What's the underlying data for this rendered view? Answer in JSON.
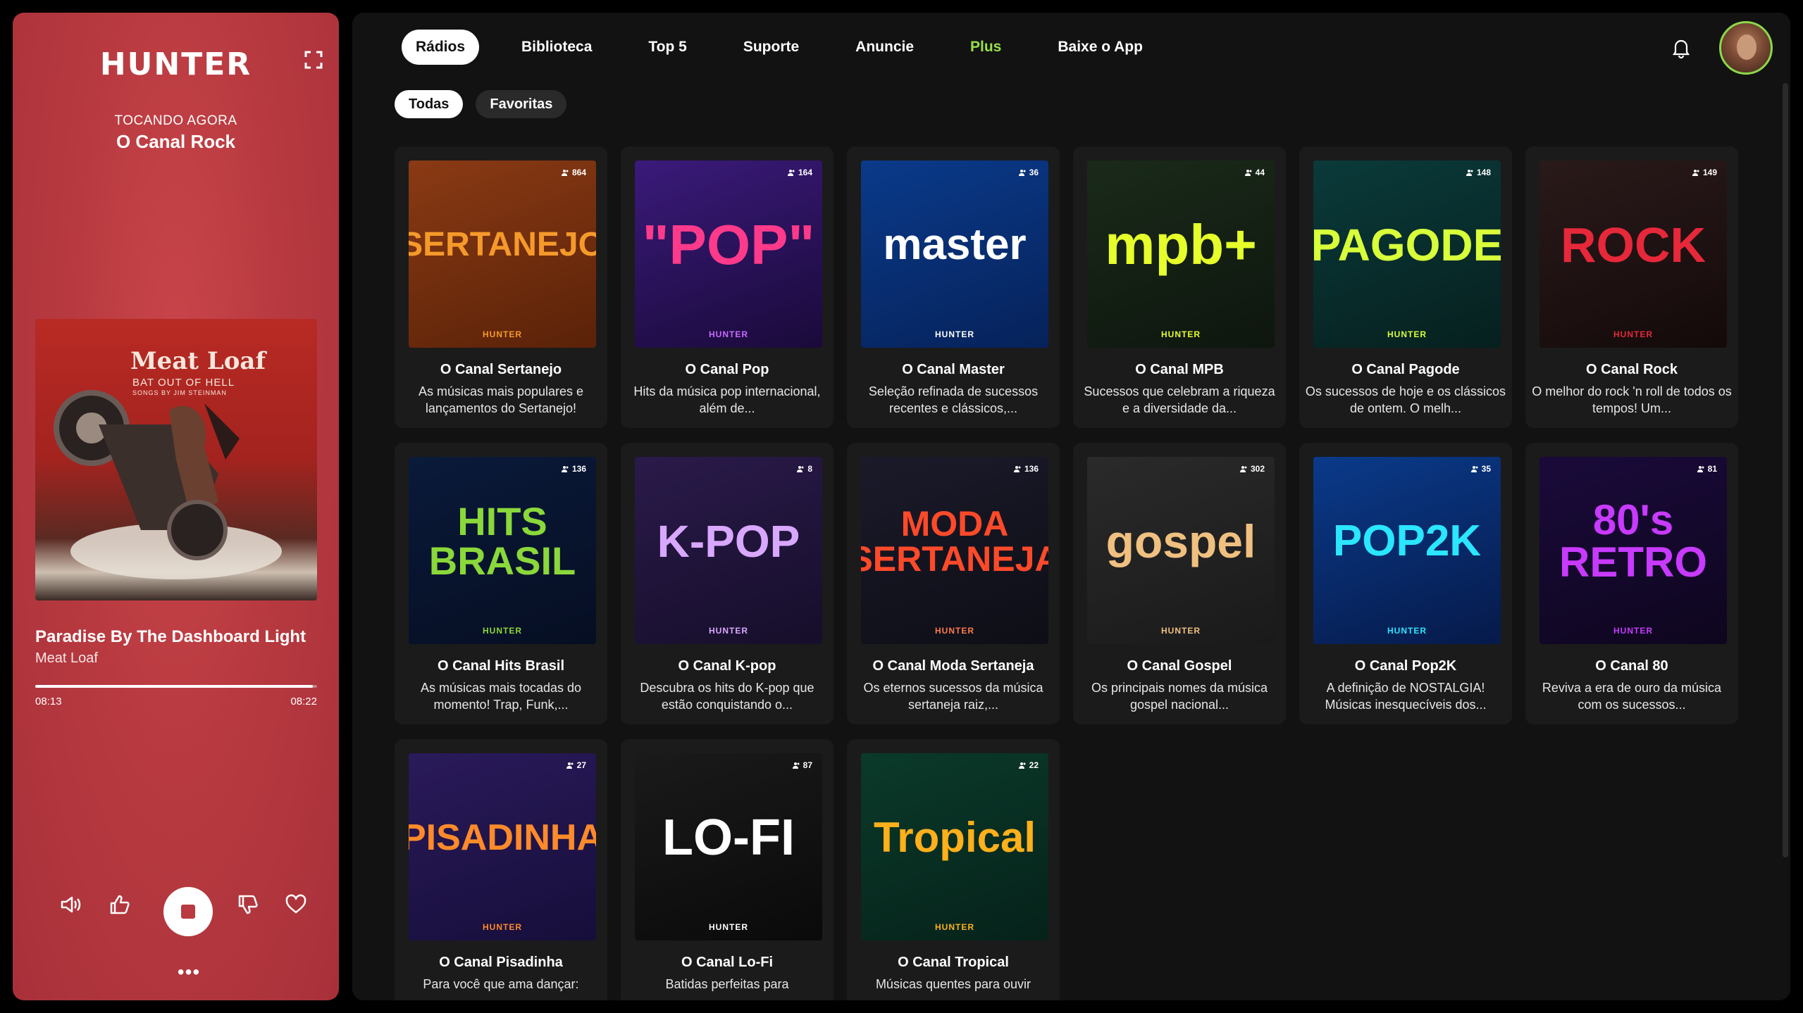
{
  "player": {
    "logo": "HUNTER",
    "now_label": "TOCANDO AGORA",
    "now_channel": "O Canal Rock",
    "album_band": "Meat Loaf",
    "album_subtitle": "BAT OUT OF HELL",
    "album_subtitle2": "SONGS BY JIM STEINMAN",
    "song_title": "Paradise By The Dashboard Light",
    "song_artist": "Meat Loaf",
    "progress": 0.985,
    "time_current": "08:13",
    "time_total": "08:22",
    "accent_color": "#b83a40"
  },
  "nav": {
    "items": [
      {
        "label": "Rádios",
        "active": true
      },
      {
        "label": "Biblioteca"
      },
      {
        "label": "Top 5"
      },
      {
        "label": "Suporte"
      },
      {
        "label": "Anuncie"
      },
      {
        "label": "Plus",
        "accent": "#97e04a"
      },
      {
        "label": "Baixe o App"
      }
    ]
  },
  "filters": [
    {
      "label": "Todas",
      "active": true
    },
    {
      "label": "Favoritas"
    }
  ],
  "channels": [
    {
      "title": "O Canal Sertanejo",
      "desc": "As músicas mais populares e lançamentos do Sertanejo!",
      "listeners": "864",
      "cover_text": "SERTANEJO",
      "brand": "HUNTER"
    },
    {
      "title": "O Canal Pop",
      "desc": "Hits da música pop internacional, além de...",
      "listeners": "164",
      "cover_text": "\"POP\"",
      "brand": "HUNTER"
    },
    {
      "title": "O Canal Master",
      "desc": "Seleção refinada de sucessos recentes e clássicos,...",
      "listeners": "36",
      "cover_text": "master",
      "brand": "HUNTER"
    },
    {
      "title": "O Canal MPB",
      "desc": "Sucessos que celebram a riqueza e a diversidade da...",
      "listeners": "44",
      "cover_text": "mpb+",
      "brand": "HUNTER"
    },
    {
      "title": "O Canal Pagode",
      "desc": "Os sucessos de hoje e os clássicos de ontem. O melh...",
      "listeners": "148",
      "cover_text": "PAGODE",
      "brand": "HUNTER"
    },
    {
      "title": "O Canal Rock",
      "desc": "O melhor do rock 'n roll de todos os tempos! Um...",
      "listeners": "149",
      "cover_text": "ROCK",
      "brand": "HUNTER"
    },
    {
      "title": "O Canal Hits Brasil",
      "desc": "As músicas mais tocadas do momento! Trap, Funk,...",
      "listeners": "136",
      "cover_text": "HITS BRASIL",
      "brand": "HUNTER"
    },
    {
      "title": "O Canal K-pop",
      "desc": "Descubra os hits do K-pop que estão conquistando o...",
      "listeners": "8",
      "cover_text": "K-POP",
      "brand": "HUNTER"
    },
    {
      "title": "O Canal Moda Sertaneja",
      "desc": "Os eternos sucessos da música sertaneja raiz,...",
      "listeners": "136",
      "cover_text": "MODA SERTANEJA",
      "brand": "HUNTER"
    },
    {
      "title": "O Canal Gospel",
      "desc": "Os principais nomes da música gospel nacional...",
      "listeners": "302",
      "cover_text": "gospel",
      "brand": "HUNTER"
    },
    {
      "title": "O Canal Pop2K",
      "desc": "A definição de NOSTALGIA! Músicas inesquecíveis dos...",
      "listeners": "35",
      "cover_text": "POP2K",
      "brand": "HUNTER"
    },
    {
      "title": "O Canal 80",
      "desc": "Reviva a era de ouro da música com os sucessos...",
      "listeners": "81",
      "cover_text": "80's RETRO",
      "brand": "HUNTER"
    },
    {
      "title": "O Canal Pisadinha",
      "desc": "Para você que ama dançar:",
      "listeners": "27",
      "cover_text": "PISADINHA",
      "brand": "HUNTER"
    },
    {
      "title": "O Canal Lo-Fi",
      "desc": "Batidas perfeitas para",
      "listeners": "87",
      "cover_text": "LO-FI",
      "brand": "HUNTER"
    },
    {
      "title": "O Canal Tropical",
      "desc": "Músicas quentes para ouvir",
      "listeners": "22",
      "cover_text": "Tropical",
      "brand": "HUNTER"
    }
  ]
}
